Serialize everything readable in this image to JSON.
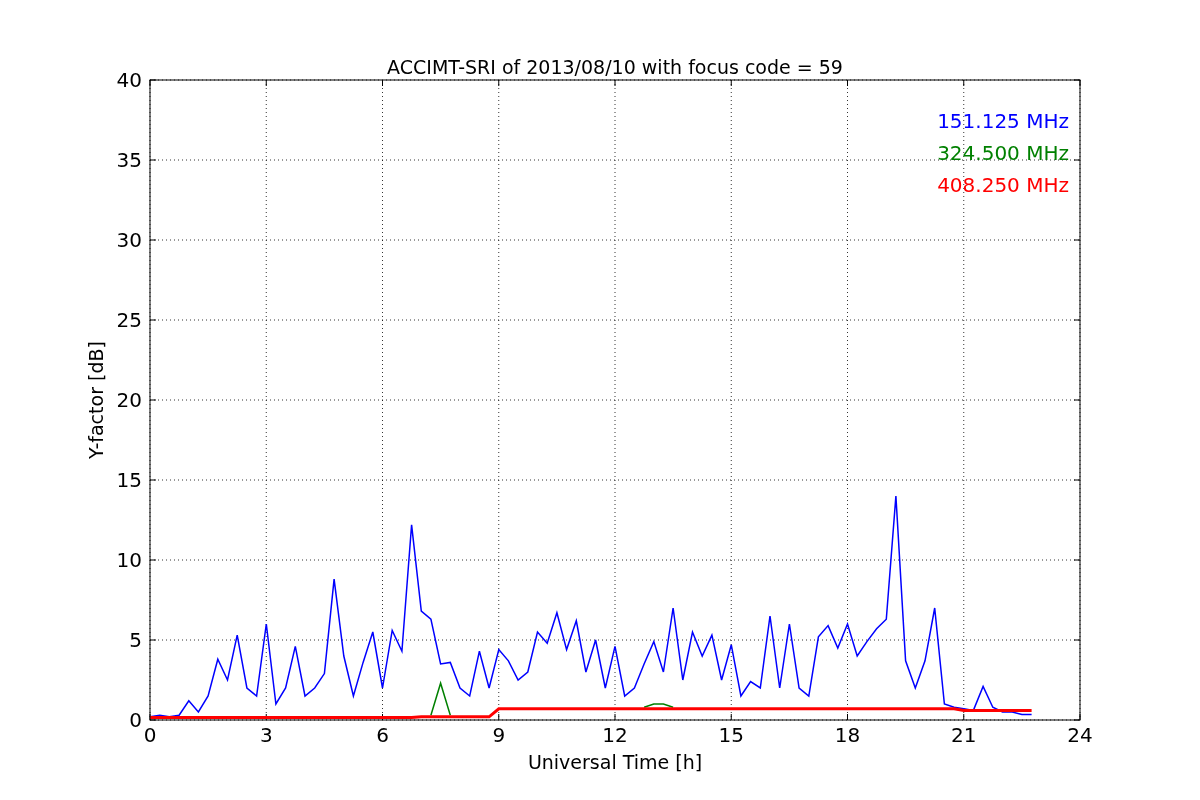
{
  "chart_data": {
    "type": "line",
    "title": "ACCIMT-SRI of 2013/08/10 with focus code = 59",
    "xlabel": "Universal Time [h]",
    "ylabel": "Y-factor [dB]",
    "x": [
      0,
      0.25,
      0.5,
      0.75,
      1,
      1.25,
      1.5,
      1.75,
      2,
      2.25,
      2.5,
      2.75,
      3,
      3.25,
      3.5,
      3.75,
      4,
      4.25,
      4.5,
      4.75,
      5,
      5.25,
      5.5,
      5.75,
      6,
      6.25,
      6.5,
      6.75,
      7,
      7.25,
      7.5,
      7.75,
      8,
      8.25,
      8.5,
      8.75,
      9,
      9.25,
      9.5,
      9.75,
      10,
      10.25,
      10.5,
      10.75,
      11,
      11.25,
      11.5,
      11.75,
      12,
      12.25,
      12.5,
      12.75,
      13,
      13.25,
      13.5,
      13.75,
      14,
      14.25,
      14.5,
      14.75,
      15,
      15.25,
      15.5,
      15.75,
      16,
      16.25,
      16.5,
      16.75,
      17,
      17.25,
      17.5,
      17.75,
      18,
      18.25,
      18.5,
      18.75,
      19,
      19.25,
      19.5,
      19.75,
      20,
      20.25,
      20.5,
      20.75,
      21,
      21.25,
      21.5,
      21.75,
      22,
      22.25,
      22.5,
      22.75
    ],
    "series": [
      {
        "name": "151.125 MHz",
        "color": "#0000ff",
        "values": [
          0.2,
          0.3,
          0.2,
          0.3,
          1.2,
          0.5,
          1.5,
          3.8,
          2.5,
          5.3,
          2,
          1.5,
          6,
          1,
          2,
          4.6,
          1.5,
          2,
          2.9,
          8.8,
          4,
          1.5,
          3.6,
          5.5,
          2,
          5.6,
          4.3,
          12.2,
          6.8,
          6.3,
          3.5,
          3.6,
          2,
          1.5,
          4.3,
          2,
          4.4,
          3.7,
          2.5,
          3,
          5.5,
          4.8,
          6.7,
          4.4,
          6.2,
          3,
          5,
          2,
          4.6,
          1.5,
          2,
          3.5,
          4.9,
          3,
          7,
          2.5,
          5.5,
          4,
          5.3,
          2.5,
          4.7,
          1.5,
          2.4,
          2,
          6.5,
          2,
          6,
          2,
          1.5,
          5.2,
          5.9,
          4.5,
          6,
          4,
          4.9,
          5.7,
          6.3,
          14,
          3.7,
          2,
          3.7,
          7,
          1,
          0.8,
          0.7,
          0.6,
          2.1,
          0.8,
          0.5,
          0.5,
          0.35,
          0.35
        ]
      },
      {
        "name": "324.500 MHz",
        "color": "#008000",
        "values": [
          null,
          null,
          null,
          null,
          null,
          null,
          null,
          null,
          null,
          null,
          null,
          null,
          null,
          null,
          null,
          null,
          null,
          null,
          null,
          null,
          null,
          null,
          null,
          null,
          null,
          null,
          null,
          null,
          null,
          0.3,
          2.3,
          0.3,
          null,
          null,
          null,
          null,
          null,
          null,
          null,
          null,
          null,
          null,
          null,
          null,
          null,
          null,
          null,
          null,
          null,
          null,
          null,
          0.8,
          1.0,
          1.0,
          0.8,
          null,
          null,
          null,
          null,
          null,
          null,
          null,
          null,
          null,
          null,
          null,
          null,
          null,
          null,
          null,
          null,
          null,
          null,
          null,
          null,
          null,
          null,
          null,
          null,
          null,
          null,
          null,
          null,
          null,
          null,
          null,
          null,
          null,
          null,
          null,
          null,
          null
        ]
      },
      {
        "name": "408.250 MHz",
        "color": "#ff0000",
        "values": [
          0.15,
          0.15,
          0.15,
          0.15,
          0.15,
          0.15,
          0.15,
          0.15,
          0.15,
          0.15,
          0.15,
          0.15,
          0.15,
          0.15,
          0.15,
          0.15,
          0.15,
          0.15,
          0.15,
          0.15,
          0.15,
          0.15,
          0.15,
          0.15,
          0.15,
          0.15,
          0.15,
          0.15,
          0.2,
          0.2,
          0.2,
          0.2,
          0.2,
          0.2,
          0.2,
          0.2,
          0.7,
          0.7,
          0.7,
          0.7,
          0.7,
          0.7,
          0.7,
          0.7,
          0.7,
          0.7,
          0.7,
          0.7,
          0.7,
          0.7,
          0.7,
          0.7,
          0.7,
          0.7,
          0.7,
          0.7,
          0.7,
          0.7,
          0.7,
          0.7,
          0.7,
          0.7,
          0.7,
          0.7,
          0.7,
          0.7,
          0.7,
          0.7,
          0.7,
          0.7,
          0.7,
          0.7,
          0.7,
          0.7,
          0.7,
          0.7,
          0.7,
          0.7,
          0.7,
          0.7,
          0.7,
          0.7,
          0.7,
          0.7,
          0.6,
          0.6,
          0.6,
          0.6,
          0.6,
          0.6,
          0.6,
          0.6
        ]
      }
    ],
    "grid": true,
    "xlim": [
      0,
      24
    ],
    "ylim": [
      0,
      40
    ],
    "xticks": [
      0,
      3,
      6,
      9,
      12,
      15,
      18,
      21,
      24
    ],
    "yticks": [
      0,
      5,
      10,
      15,
      20,
      25,
      30,
      35,
      40
    ]
  }
}
